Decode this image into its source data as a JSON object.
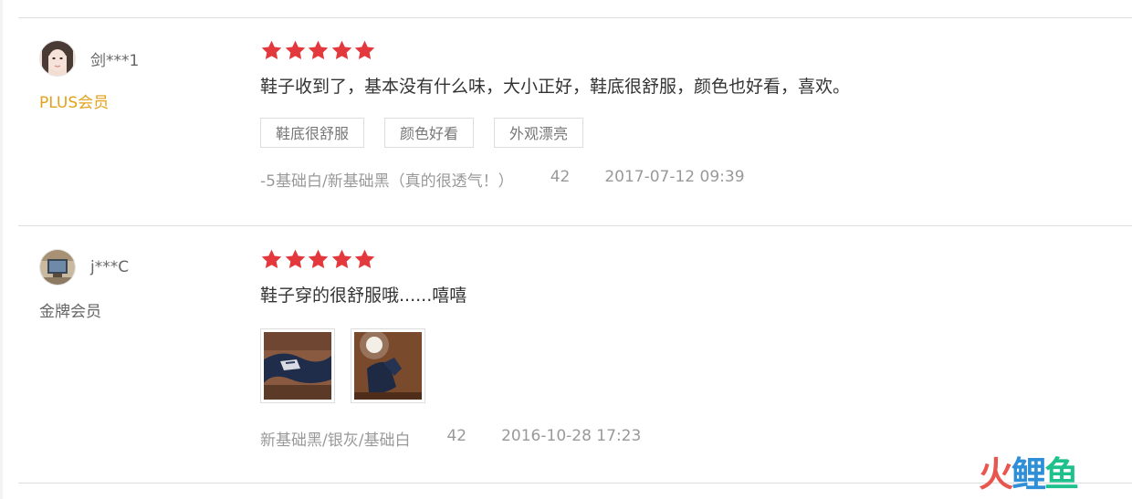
{
  "reviews": [
    {
      "username": "剑***1",
      "member_level": "PLUS会员",
      "rating_stars": 5,
      "comment": "鞋子收到了，基本没有什么味，大小正好，鞋底很舒服，颜色也好看，喜欢。",
      "tags": [
        "鞋底很舒服",
        "颜色好看",
        "外观漂亮"
      ],
      "color_variant": "-5基础白/新基础黑（真的很透气！）",
      "size": "42",
      "date": "2017-07-12 09:39"
    },
    {
      "username": "j***C",
      "member_level": "金牌会员",
      "rating_stars": 5,
      "comment": "鞋子穿的很舒服哦......嘻嘻",
      "images": [
        "shoe-photo-1",
        "shoe-photo-2"
      ],
      "color_variant": "新基础黑/银灰/基础白",
      "size": "42",
      "date": "2016-10-28 17:23"
    }
  ],
  "watermark": {
    "chars": [
      "火",
      "鲤",
      "鱼"
    ]
  },
  "colors": {
    "star": "#e4393c",
    "plus_member": "#e3a21a",
    "meta_text": "#999999",
    "divider": "#dddddd"
  }
}
